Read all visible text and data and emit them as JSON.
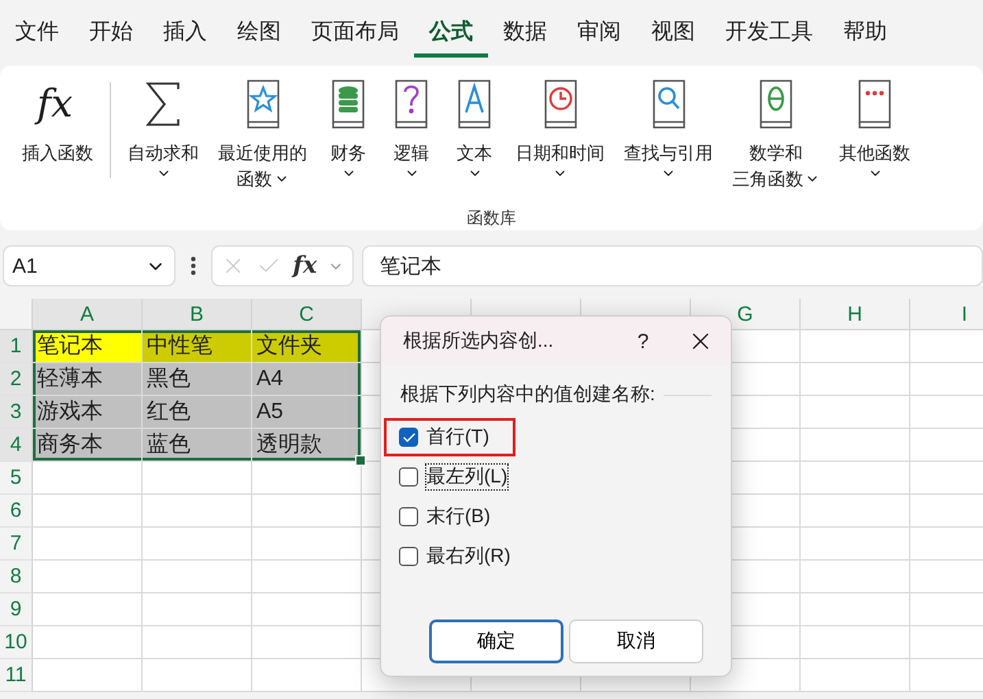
{
  "menu_tabs": [
    {
      "label": "文件",
      "selected": false
    },
    {
      "label": "开始",
      "selected": false
    },
    {
      "label": "插入",
      "selected": false
    },
    {
      "label": "绘图",
      "selected": false
    },
    {
      "label": "页面布局",
      "selected": false
    },
    {
      "label": "公式",
      "selected": true
    },
    {
      "label": "数据",
      "selected": false
    },
    {
      "label": "审阅",
      "selected": false
    },
    {
      "label": "视图",
      "selected": false
    },
    {
      "label": "开发工具",
      "selected": false
    },
    {
      "label": "帮助",
      "selected": false
    }
  ],
  "ribbon": {
    "group_label": "函数库",
    "items": [
      {
        "kind": "fx",
        "symbol": "fx",
        "label": "插入函数",
        "dropdown": false
      },
      {
        "kind": "sigma",
        "label": "自动求和",
        "dropdown": true
      },
      {
        "kind": "star",
        "label": "最近使用的",
        "label_2": "函数",
        "dropdown": true
      },
      {
        "kind": "coins",
        "label": "财务",
        "dropdown": true
      },
      {
        "kind": "question",
        "label": "逻辑",
        "dropdown": true
      },
      {
        "kind": "letter",
        "label": "文本",
        "dropdown": true
      },
      {
        "kind": "clock",
        "label": "日期和时间",
        "dropdown": true
      },
      {
        "kind": "search",
        "label": "查找与引用",
        "dropdown": true
      },
      {
        "kind": "theta",
        "label": "数学和",
        "label_2": "三角函数",
        "dropdown": true
      },
      {
        "kind": "dots",
        "label": "其他函数",
        "dropdown": true
      }
    ]
  },
  "formula_bar": {
    "name_box": "A1",
    "fx": "fx",
    "value": "笔记本"
  },
  "sheet": {
    "columns": [
      {
        "label": "A",
        "selected": true
      },
      {
        "label": "B",
        "selected": true
      },
      {
        "label": "C",
        "selected": true
      },
      {
        "selected": false
      },
      {
        "selected": false
      },
      {
        "selected": false
      },
      {
        "label": "G",
        "selected": false
      },
      {
        "label": "H",
        "selected": false
      },
      {
        "label": "I",
        "selected": false
      }
    ],
    "rows": [
      {
        "number": "1",
        "selected": true,
        "cells": [
          {
            "text": "笔记本",
            "color": "#ffff00"
          },
          {
            "text": "中性笔",
            "color": "#cccc00"
          },
          {
            "text": "文件夹",
            "color": "#cccc00"
          }
        ]
      },
      {
        "number": "2",
        "selected": true,
        "cells": [
          {
            "text": "轻薄本",
            "color": "#c0c0c0"
          },
          {
            "text": "黑色",
            "color": "#c0c0c0"
          },
          {
            "text": "A4",
            "color": "#c0c0c0"
          }
        ]
      },
      {
        "number": "3",
        "selected": true,
        "cells": [
          {
            "text": "游戏本",
            "color": "#c0c0c0"
          },
          {
            "text": "红色",
            "color": "#c0c0c0"
          },
          {
            "text": "A5",
            "color": "#c0c0c0"
          }
        ]
      },
      {
        "number": "4",
        "selected": true,
        "cells": [
          {
            "text": "商务本",
            "color": "#c0c0c0"
          },
          {
            "text": "蓝色",
            "color": "#c0c0c0"
          },
          {
            "text": "透明款",
            "color": "#c0c0c0"
          }
        ]
      },
      {
        "number": "5",
        "selected": false
      },
      {
        "number": "6",
        "selected": false
      },
      {
        "number": "7",
        "selected": false
      },
      {
        "number": "8",
        "selected": false
      },
      {
        "number": "9",
        "selected": false
      },
      {
        "number": "10",
        "selected": false
      },
      {
        "number": "11",
        "selected": false
      }
    ]
  },
  "dialog": {
    "title": "根据所选内容创...",
    "help": "?",
    "prompt": "根据下列内容中的值创建名称:",
    "options": [
      {
        "text": "首行(T)",
        "checked": true,
        "focused": false,
        "highlighted": true
      },
      {
        "text": "最左列(L)",
        "checked": false,
        "focused": true,
        "highlighted": false
      },
      {
        "text": "末行(B)",
        "checked": false,
        "focused": false,
        "highlighted": false
      },
      {
        "text": "最右列(R)",
        "checked": false,
        "focused": false,
        "highlighted": false
      }
    ],
    "buttons": [
      {
        "label": "确定",
        "default": true
      },
      {
        "label": "取消",
        "default": false
      }
    ]
  }
}
